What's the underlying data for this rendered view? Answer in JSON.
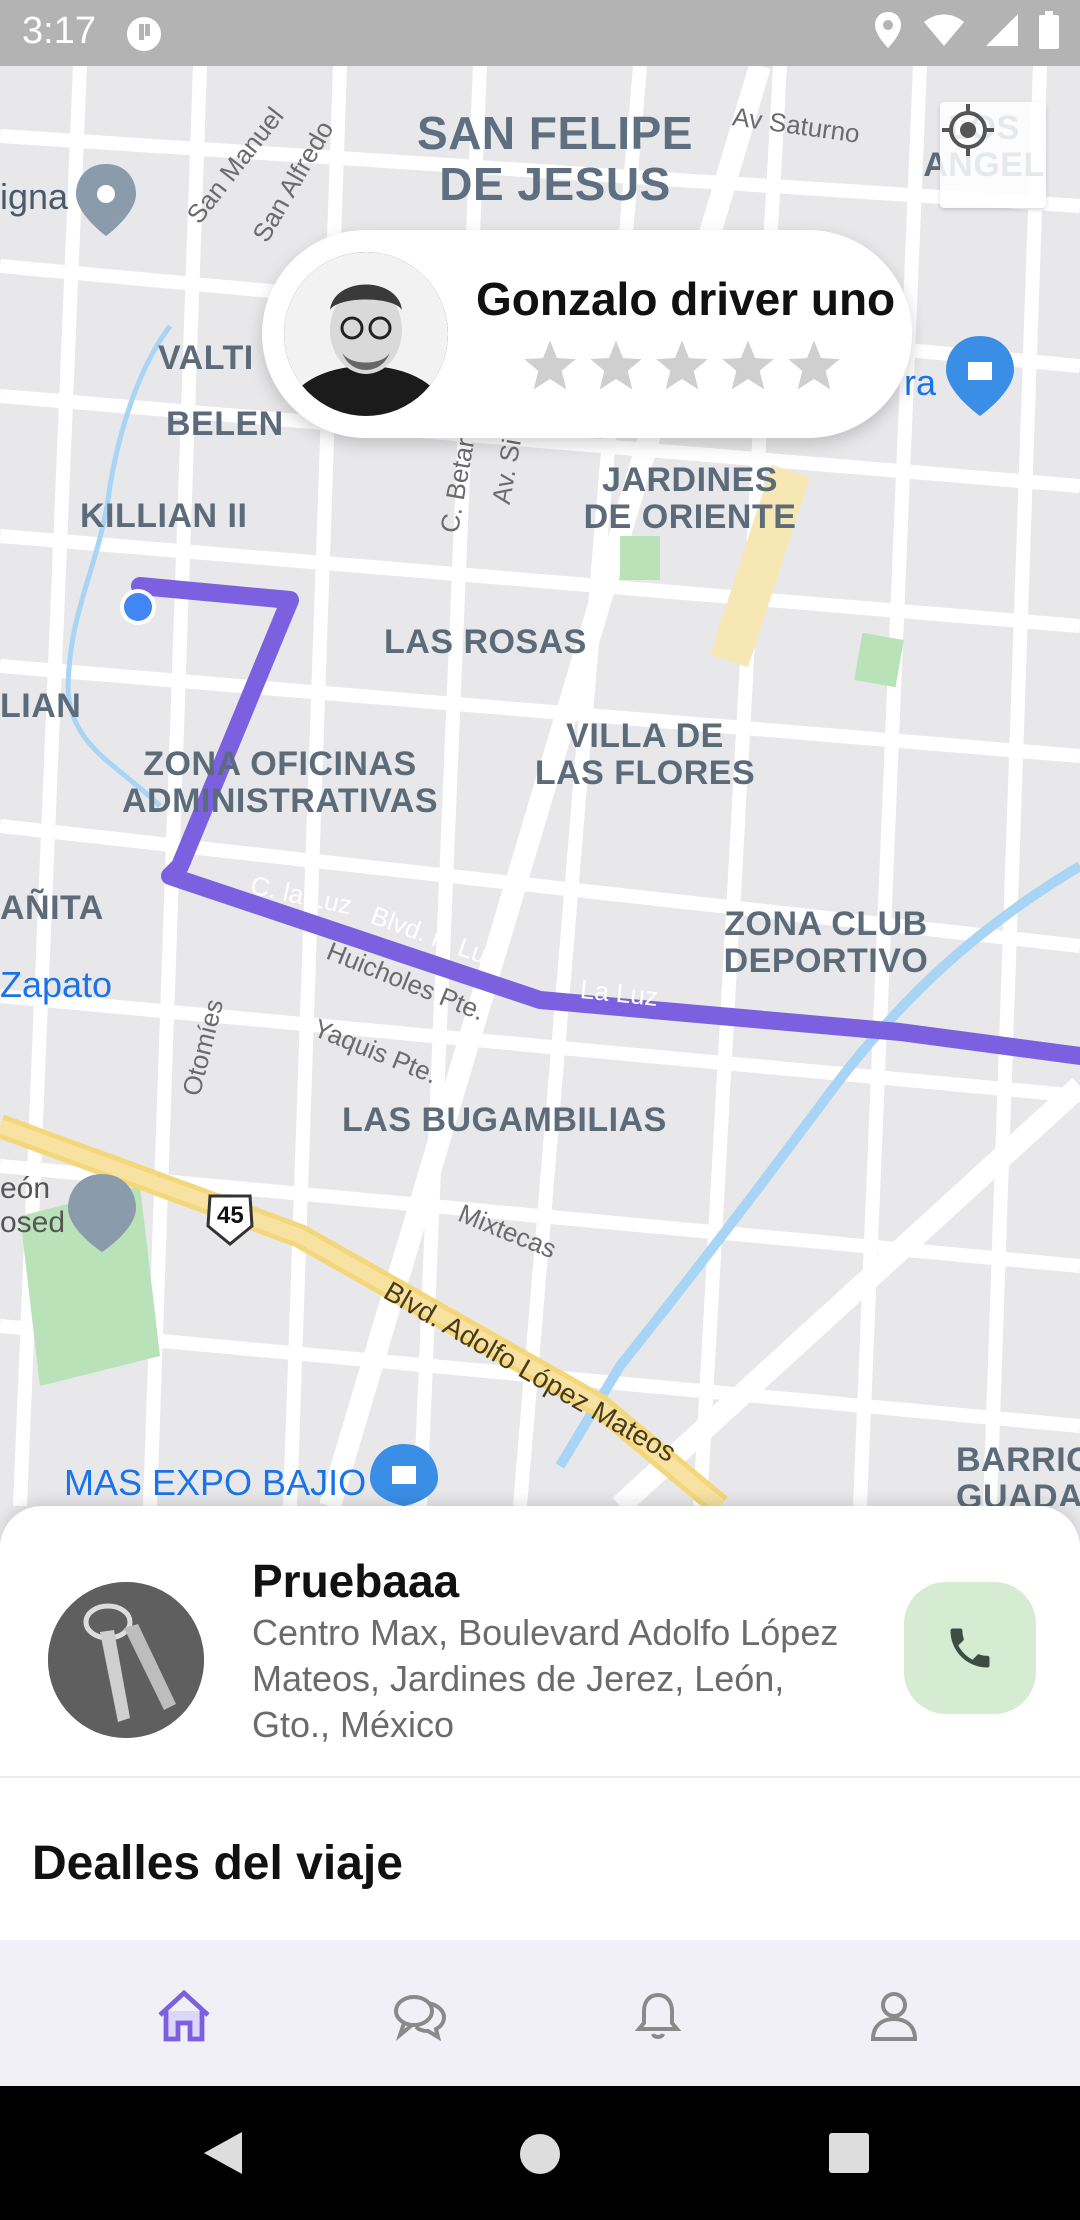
{
  "status_bar": {
    "time": "3:17"
  },
  "map": {
    "areas": [
      {
        "text": "SAN FELIPE\nDE JESUS"
      },
      {
        "text": "VALTI"
      },
      {
        "text": "BELEN"
      },
      {
        "text": "KILLIAN II"
      },
      {
        "text": "JARDINES\nDE ORIENTE"
      },
      {
        "text": "LAS ROSAS"
      },
      {
        "text": "LIAN"
      },
      {
        "text": "ZONA OFICINAS\nADMINISTRATIVAS"
      },
      {
        "text": "VILLA DE\nLAS FLORES"
      },
      {
        "text": "AÑITA"
      },
      {
        "text": "ZONA CLUB\nDEPORTIVO"
      },
      {
        "text": "LAS BUGAMBILIAS"
      },
      {
        "text": "LOS ANGEL"
      },
      {
        "text": "BARRIO\nGUADAL"
      }
    ],
    "streets": [
      {
        "text": "Av Saturno"
      },
      {
        "text": "San Manuel"
      },
      {
        "text": "San Alfredo"
      },
      {
        "text": "C. Betar"
      },
      {
        "text": "Av. Si"
      },
      {
        "text": "C. la Luz"
      },
      {
        "text": "Blvd. la Luz"
      },
      {
        "text": "La Luz"
      },
      {
        "text": "Huicholes Pte."
      },
      {
        "text": "Yaquis Pte."
      },
      {
        "text": "Otomíes"
      },
      {
        "text": "Mixtecas"
      },
      {
        "text": "Blvd. Adolfo López Mateos"
      },
      {
        "text": "45"
      }
    ],
    "places": [
      {
        "text": "igna"
      },
      {
        "text": "ra"
      },
      {
        "text": "Zapato"
      },
      {
        "text": "MAS EXPO BAJIO"
      },
      {
        "text": "eón\nosed"
      }
    ],
    "route_color": "#7b61e0"
  },
  "driver": {
    "name": "Gonzalo driver uno",
    "rating_stars": 5,
    "rating_filled": 0
  },
  "trip": {
    "title": "Pruebaaa",
    "address": "Centro Max, Boulevard Adolfo López Mateos, Jardines de Jerez, León, Gto., México",
    "details_heading": "Dealles del viaje"
  },
  "tabs": [
    {
      "icon": "home-icon",
      "active": true
    },
    {
      "icon": "chat-icon",
      "active": false
    },
    {
      "icon": "bell-icon",
      "active": false
    },
    {
      "icon": "profile-icon",
      "active": false
    }
  ],
  "colors": {
    "accent": "#7b61e0",
    "call_button_bg": "#d6ecd2",
    "call_icon": "#3d4d44",
    "tabbar_bg": "#f1f0f7"
  }
}
